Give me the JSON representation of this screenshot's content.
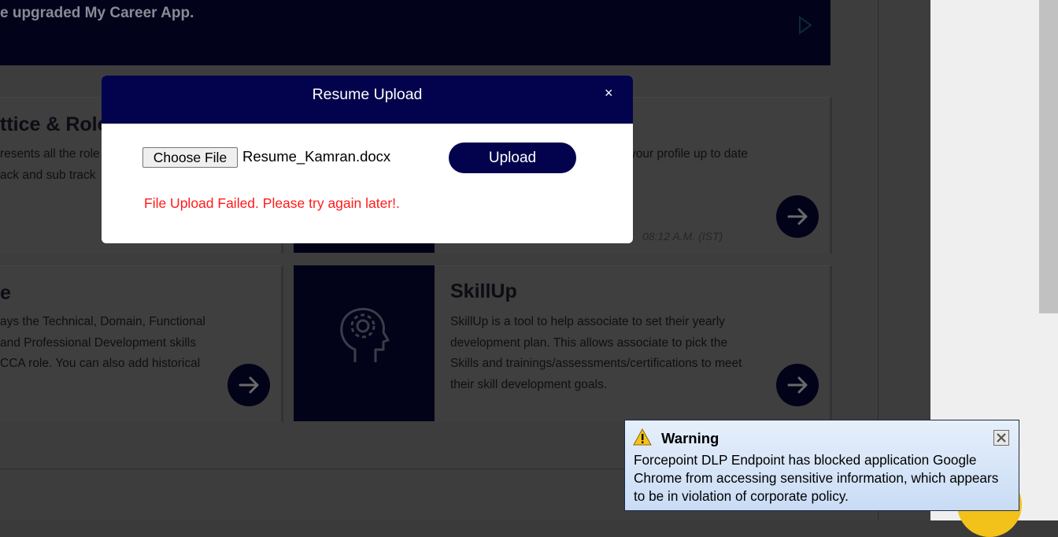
{
  "banner": {
    "text": "e upgraded My Career App.",
    "play_icon": "play-triangle-icon"
  },
  "cards": {
    "lattice": {
      "title": "ttice & Role",
      "desc": [
        "resents all the role",
        "ack and sub track"
      ]
    },
    "profile": {
      "desc": "your profile up to date",
      "timestamp": "08:12 A.M. (IST)"
    },
    "skills": {
      "title": "e",
      "desc": [
        "ays the Technical, Domain, Functional",
        "and Professional Development skills",
        "CCA role. You can also add historical"
      ]
    },
    "skillup": {
      "title": "SkillUp",
      "desc": [
        "SkillUp is a tool to help associate to set their yearly",
        "development plan. This allows associate to pick the",
        "Skills and trainings/assessments/certifications to meet",
        "their skill development goals."
      ],
      "image_icon": "head-gear-icon"
    }
  },
  "modal": {
    "title": "Resume Upload",
    "close_label": "×",
    "choose_file_label": "Choose File",
    "file_name": "Resume_Kamran.docx",
    "upload_label": "Upload",
    "error": "File Upload Failed. Please try again later!."
  },
  "dlp": {
    "title": "Warning",
    "message": "Forcepoint DLP Endpoint has blocked application Google Chrome from accessing sensitive information, which appears to be in violation of corporate policy."
  },
  "colors": {
    "navy": "#03034d",
    "error_red": "#ff1a1a",
    "overlay_dark": "#3d3d3d"
  }
}
